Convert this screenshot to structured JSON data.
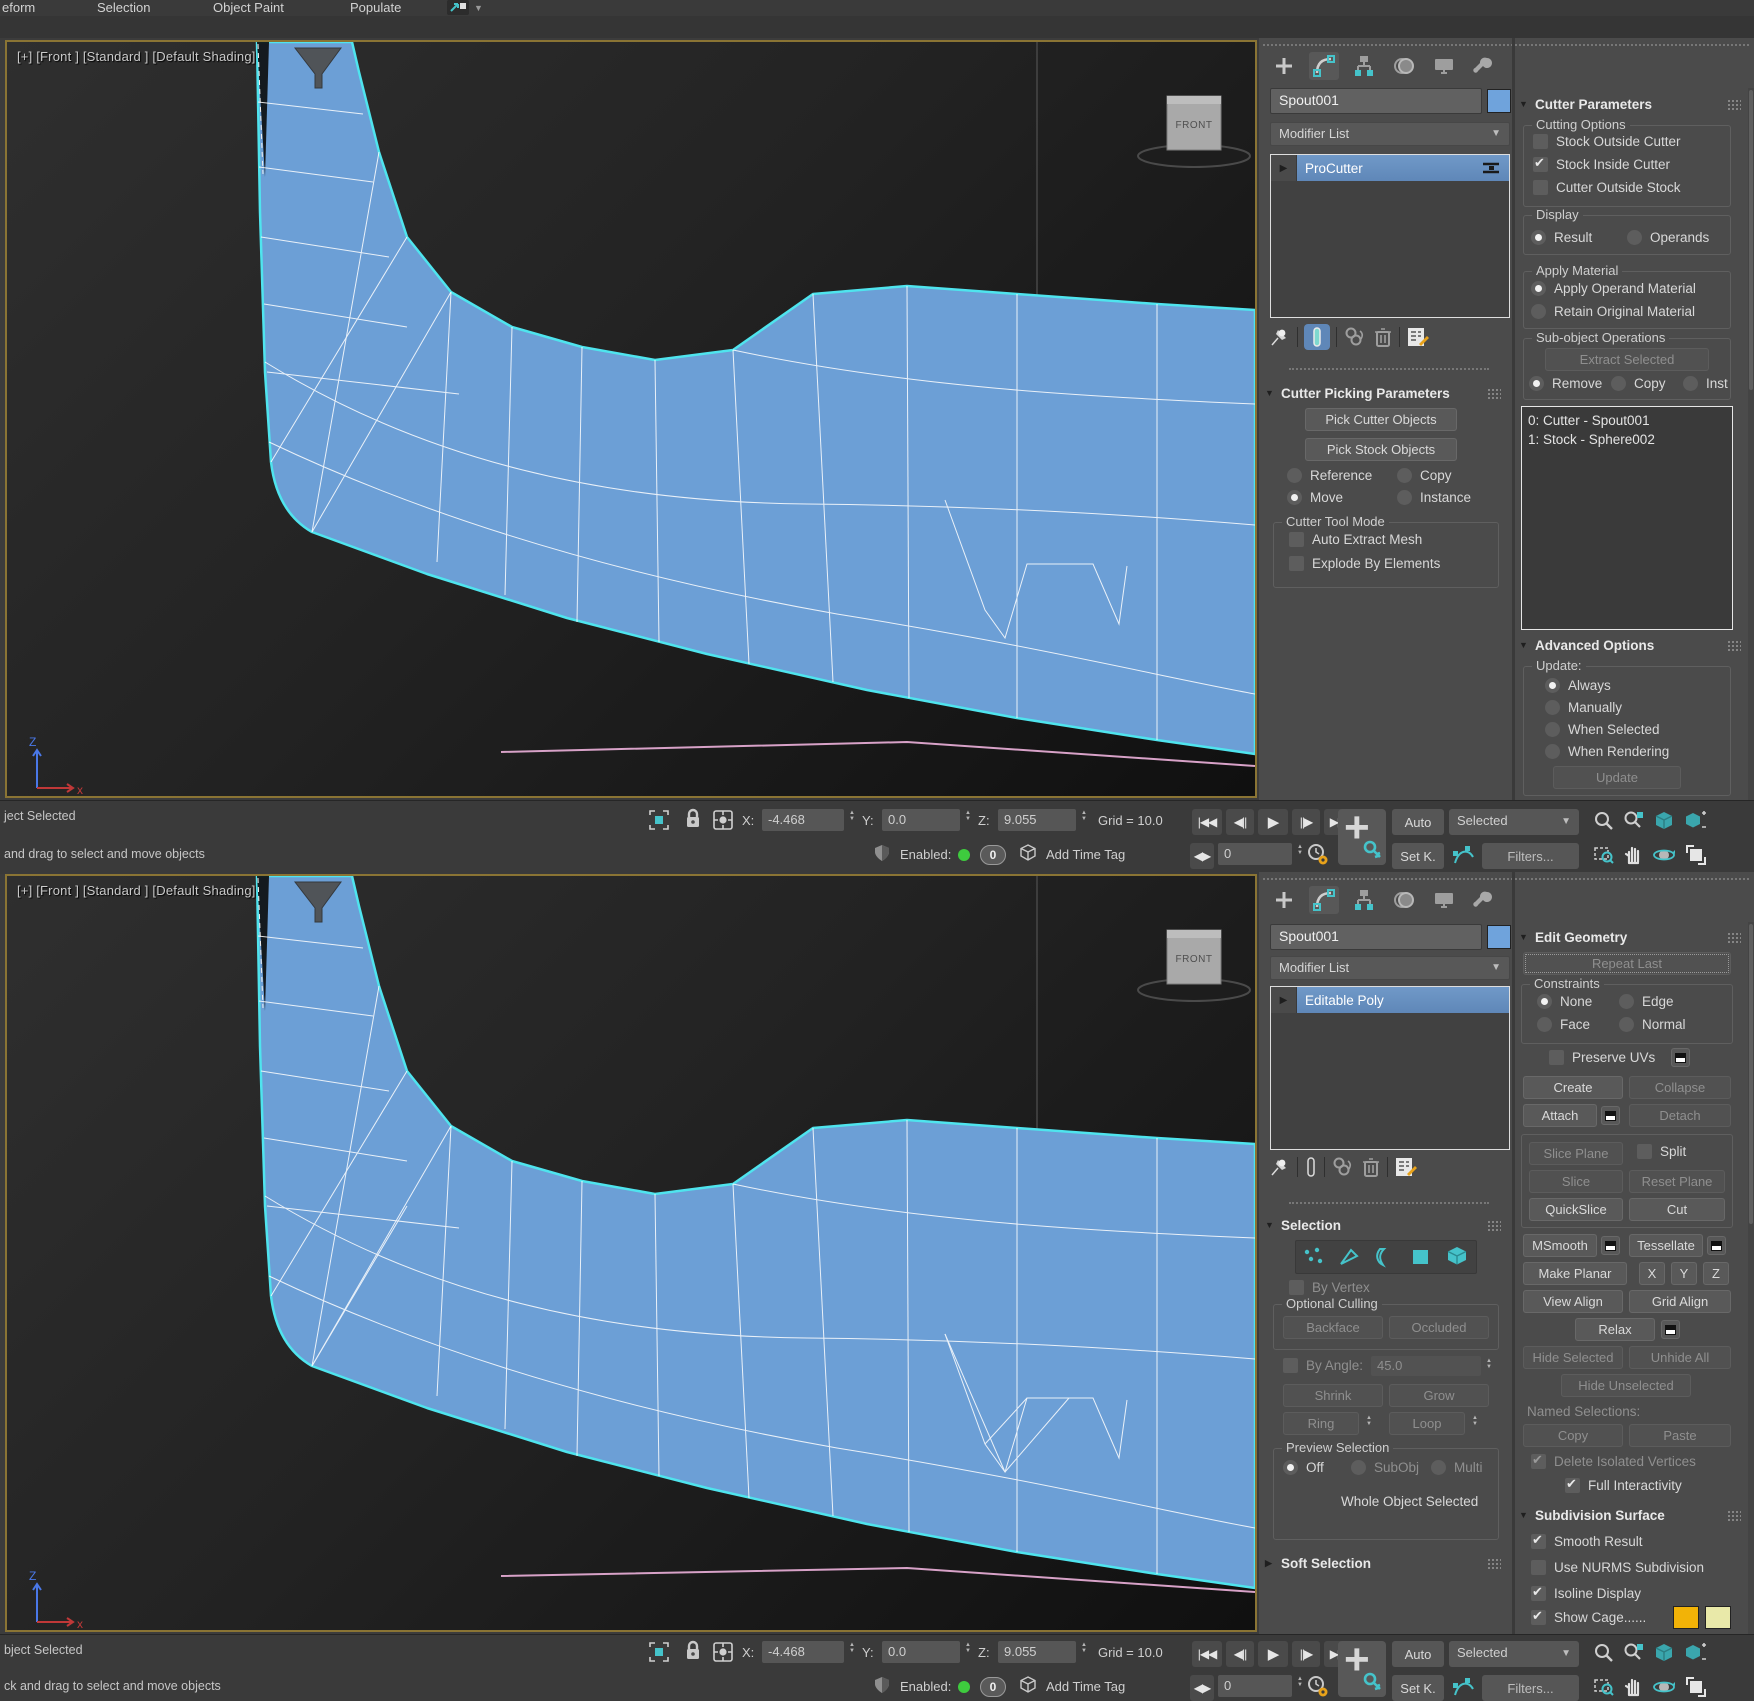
{
  "ribbon": {
    "tabs": [
      "eform",
      "Selection",
      "Object Paint",
      "Populate"
    ]
  },
  "viewport": {
    "label": "[+] [Front ] [Standard ] [Default Shading]",
    "viewcube": "FRONT",
    "axis_x": "x",
    "axis_z": "Z"
  },
  "panel_top": {
    "name": "Spout001",
    "modifier_list": "Modifier List",
    "stack_item": "ProCutter",
    "picking": {
      "title": "Cutter Picking Parameters",
      "pick_cutter": "Pick Cutter Objects",
      "pick_stock": "Pick Stock Objects",
      "r_reference": "Reference",
      "r_copy": "Copy",
      "r_move": "Move",
      "r_instance": "Instance",
      "group": "Cutter Tool Mode",
      "cb_auto": "Auto Extract Mesh",
      "cb_explode": "Explode By Elements"
    },
    "params": {
      "title": "Cutter Parameters",
      "g_cutting": "Cutting Options",
      "cb_stock_outside": "Stock Outside Cutter",
      "cb_stock_inside": "Stock Inside Cutter",
      "cb_cutter_outside": "Cutter Outside Stock",
      "g_display": "Display",
      "r_result": "Result",
      "r_operands": "Operands",
      "g_apply": "Apply Material",
      "r_apply_operand": "Apply Operand Material",
      "r_retain": "Retain Original Material",
      "g_subobj": "Sub-object Operations",
      "b_extract": "Extract Selected",
      "r_remove": "Remove",
      "r_copy": "Copy",
      "r_inst": "Inst",
      "list": [
        "0: Cutter - Spout001",
        "1: Stock - Sphere002"
      ]
    },
    "advanced": {
      "title": "Advanced Options",
      "g_update": "Update:",
      "r_always": "Always",
      "r_manually": "Manually",
      "r_when_selected": "When Selected",
      "r_when_rendering": "When Rendering",
      "b_update": "Update"
    }
  },
  "panel_bottom": {
    "name": "Spout001",
    "modifier_list": "Modifier List",
    "stack_item": "Editable Poly",
    "selection": {
      "title": "Selection",
      "cb_by_vertex": "By Vertex",
      "g_culling": "Optional Culling",
      "b_backface": "Backface",
      "b_occluded": "Occluded",
      "cb_by_angle": "By Angle:",
      "angle_value": "45.0",
      "b_shrink": "Shrink",
      "b_grow": "Grow",
      "b_ring": "Ring",
      "b_loop": "Loop",
      "g_preview": "Preview Selection",
      "r_off": "Off",
      "r_subobj": "SubObj",
      "r_multi": "Multi",
      "status": "Whole Object Selected"
    },
    "soft_selection_title": "Soft Selection",
    "editgeo": {
      "title": "Edit Geometry",
      "b_repeat": "Repeat Last",
      "g_constraints": "Constraints",
      "r_none": "None",
      "r_edge": "Edge",
      "r_face": "Face",
      "r_normal": "Normal",
      "cb_preserve": "Preserve UVs",
      "b_create": "Create",
      "b_collapse": "Collapse",
      "b_attach": "Attach",
      "b_detach": "Detach",
      "b_slice_plane": "Slice Plane",
      "cb_split": "Split",
      "b_slice": "Slice",
      "b_reset_plane": "Reset Plane",
      "b_quickslice": "QuickSlice",
      "b_cut": "Cut",
      "b_msmooth": "MSmooth",
      "b_tessellate": "Tessellate",
      "b_make_planar": "Make Planar",
      "b_x": "X",
      "b_y": "Y",
      "b_z": "Z",
      "b_view_align": "View Align",
      "b_grid_align": "Grid Align",
      "b_relax": "Relax",
      "b_hide_sel": "Hide Selected",
      "b_unhide": "Unhide All",
      "b_hide_unsel": "Hide Unselected",
      "named_label": "Named Selections:",
      "b_copy": "Copy",
      "b_paste": "Paste",
      "cb_delete_iso": "Delete Isolated Vertices",
      "cb_full_inter": "Full Interactivity"
    },
    "subdiv": {
      "title": "Subdivision Surface",
      "cb_smooth": "Smooth Result",
      "cb_nurms": "Use NURMS Subdivision",
      "cb_isoline": "Isoline Display",
      "cb_cage": "Show Cage......",
      "cage_colors": [
        "#f2b307",
        "#e9e9a9"
      ]
    }
  },
  "sb_top": {
    "line1": "ject Selected",
    "line2": "and drag to select and move objects",
    "x_label": "X:",
    "x": "-4.468",
    "y_label": "Y:",
    "y": "0.0",
    "z_label": "Z:",
    "z": "9.055",
    "grid": "Grid = 10.0",
    "enabled_label": "Enabled:",
    "enabled_count": "0",
    "add_time_tag": "Add Time Tag",
    "frame": "0",
    "auto": "Auto",
    "selected": "Selected",
    "set_k": "Set K.",
    "filters": "Filters...",
    "t_start": "|◀◀",
    "t_prev": "◀||",
    "t_play": "▶",
    "t_next": "||▶",
    "t_end": "▶▶|",
    "t_mode": "◀▶"
  },
  "sb_bottom": {
    "line1": "bject Selected",
    "line2": "ck and drag to select and move objects",
    "x_label": "X:",
    "x": "-4.468",
    "y_label": "Y:",
    "y": "0.0",
    "z_label": "Z:",
    "z": "9.055",
    "grid": "Grid = 10.0",
    "enabled_label": "Enabled:",
    "enabled_count": "0",
    "add_time_tag": "Add Time Tag",
    "frame": "0",
    "auto": "Auto",
    "selected": "Selected",
    "set_k": "Set K.",
    "filters": "Filters...",
    "t_start": "|◀◀",
    "t_prev": "◀||",
    "t_play": "▶",
    "t_next": "||▶",
    "t_end": "▶▶|",
    "t_mode": "◀▶"
  },
  "colors": {
    "accent_blue_swatch": "#6fa3dc",
    "selection_cyan": "#4fe4ee",
    "mesh_blue": "#6c9fd6",
    "stack_selected_blue": "#6a92c4",
    "ui_teal": "#45c3ca",
    "enabled_green": "#3ecb3e",
    "viewport_border": "#8a7434"
  },
  "icons": {
    "create-tab-icon": "plus",
    "modify-tab-icon": "bezier-arc",
    "hierarchy-tab-icon": "node-tree",
    "motion-tab-icon": "rings",
    "display-tab-icon": "monitor",
    "utilities-tab-icon": "wrench",
    "pin-stack-icon": "pushpin",
    "show-end-result-icon": "test-tube",
    "make-unique-icon": "linked-spheres",
    "remove-modifier-icon": "trash",
    "configure-modifier-sets-icon": "sheet-pencil",
    "selection-region-icon": "bracket-square",
    "lock-selection-icon": "padlock",
    "absolute-mode-icon": "gizmo-square",
    "time-config-icon": "clock-gear",
    "set-keys-icon": "plus-key",
    "key-filters-icon": "curve-handles",
    "shield-icon": "shield",
    "time-tag-icon": "cube-outline",
    "zoom-icon": "magnifier",
    "zoom-all-icon": "magnifier-multi",
    "zoom-extents-icon": "teal-cube",
    "zoom-extents-all-icon": "teal-cube-multi",
    "region-zoom-icon": "dashed-magnifier",
    "pan-icon": "hand",
    "orbit-icon": "orbit-sphere",
    "maximize-viewport-icon": "corner-arrows",
    "funnel-icon": "funnel",
    "subobj-vertex-icon": "dots",
    "subobj-edge-icon": "triangle",
    "subobj-border-icon": "arc",
    "subobj-polygon-icon": "filled-square",
    "subobj-element-icon": "cube"
  }
}
